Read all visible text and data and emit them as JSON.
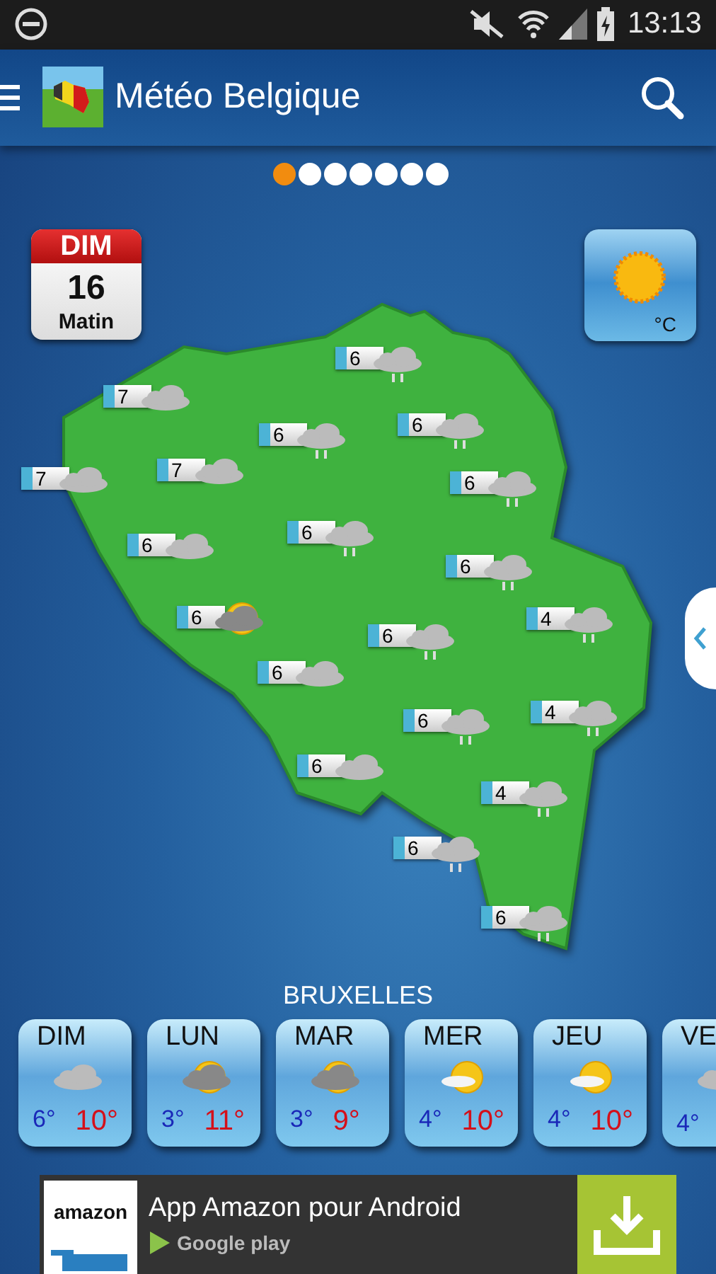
{
  "status_bar": {
    "time": "13:13"
  },
  "app_bar": {
    "title": "Météo Belgique"
  },
  "pager": [
    {
      "selected": true
    },
    {
      "selected": false
    },
    {
      "selected": false
    },
    {
      "selected": false
    },
    {
      "selected": false
    },
    {
      "selected": false
    },
    {
      "selected": false
    }
  ],
  "calendar": {
    "day": "DIM",
    "date": "16",
    "period": "Matin"
  },
  "unit_button": {
    "label": "°C"
  },
  "map_markers": [
    {
      "temp": "6",
      "kind": "rain"
    },
    {
      "temp": "7",
      "kind": "cloud"
    },
    {
      "temp": "6",
      "kind": "rain"
    },
    {
      "temp": "6",
      "kind": "rain"
    },
    {
      "temp": "7",
      "kind": "cloud"
    },
    {
      "temp": "7",
      "kind": "cloud"
    },
    {
      "temp": "6",
      "kind": "rain"
    },
    {
      "temp": "6",
      "kind": "cloud"
    },
    {
      "temp": "6",
      "kind": "rain"
    },
    {
      "temp": "6",
      "kind": "rain"
    },
    {
      "temp": "6",
      "kind": "sun-cloud"
    },
    {
      "temp": "6",
      "kind": "rain"
    },
    {
      "temp": "4",
      "kind": "rain"
    },
    {
      "temp": "6",
      "kind": "cloud"
    },
    {
      "temp": "6",
      "kind": "rain"
    },
    {
      "temp": "4",
      "kind": "rain"
    },
    {
      "temp": "6",
      "kind": "cloud"
    },
    {
      "temp": "4",
      "kind": "rain"
    },
    {
      "temp": "6",
      "kind": "rain"
    },
    {
      "temp": "6",
      "kind": "rain"
    }
  ],
  "forecast": {
    "city": "BRUXELLES",
    "days": [
      {
        "day": "DIM",
        "kind": "cloud",
        "low": "6°",
        "high": "10°"
      },
      {
        "day": "LUN",
        "kind": "sun-cloud",
        "low": "3°",
        "high": "11°"
      },
      {
        "day": "MAR",
        "kind": "sun-cloud",
        "low": "3°",
        "high": "9°"
      },
      {
        "day": "MER",
        "kind": "sun-haze",
        "low": "4°",
        "high": "10°"
      },
      {
        "day": "JEU",
        "kind": "sun-haze",
        "low": "4°",
        "high": "10°"
      },
      {
        "day": "VE",
        "kind": "cloud",
        "low": "4°"
      }
    ]
  },
  "ad": {
    "brand": "amazon",
    "title": "App Amazon pour Android",
    "store": "Google play"
  }
}
